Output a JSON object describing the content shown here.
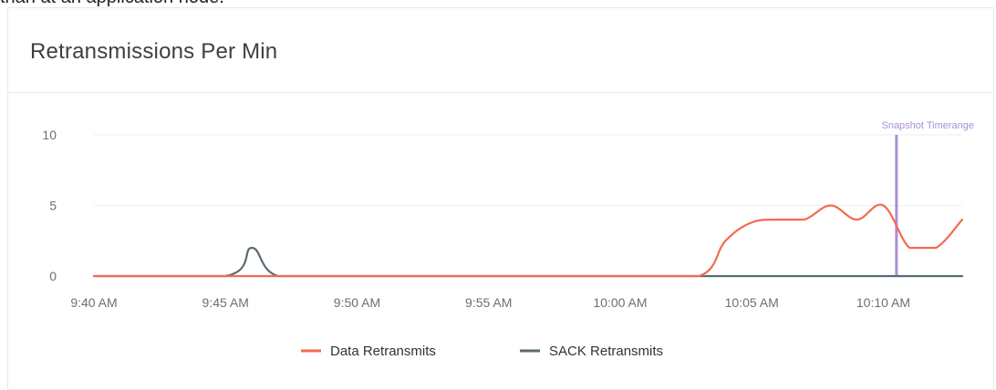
{
  "page": {
    "top_caption": "than at an application node."
  },
  "panel": {
    "title": "Retransmissions Per Min"
  },
  "colors": {
    "data_retransmits": "#f26b4e",
    "sack_retransmits": "#5a6a72",
    "snapshot_line": "#a98fd8",
    "grid": "#eeeeee"
  },
  "chart_data": {
    "type": "line",
    "title": "Retransmissions Per Min",
    "xlabel": "",
    "ylabel": "",
    "ylim": [
      0,
      10
    ],
    "y_ticks": [
      "0",
      "5",
      "10"
    ],
    "x_tick_labels": [
      "9:40 AM",
      "9:45 AM",
      "9:50 AM",
      "9:55 AM",
      "10:00 AM",
      "10:05 AM",
      "10:10 AM"
    ],
    "xlim": [
      "9:40",
      "10:13"
    ],
    "grid": true,
    "legend_position": "bottom",
    "series": [
      {
        "name": "Data Retransmits",
        "color": "#f26b4e",
        "points": [
          [
            "9:40",
            0
          ],
          [
            "9:45",
            0
          ],
          [
            "9:50",
            0
          ],
          [
            "9:55",
            0
          ],
          [
            "10:00",
            0
          ],
          [
            "10:03",
            0
          ],
          [
            "10:04",
            2.5
          ],
          [
            "10:05",
            3.8
          ],
          [
            "10:06",
            4
          ],
          [
            "10:07",
            4
          ],
          [
            "10:08",
            5
          ],
          [
            "10:09",
            4
          ],
          [
            "10:10",
            5
          ],
          [
            "10:11",
            2
          ],
          [
            "10:12",
            2
          ],
          [
            "10:13",
            4
          ]
        ]
      },
      {
        "name": "SACK Retransmits",
        "color": "#5a6a72",
        "points": [
          [
            "9:40",
            0
          ],
          [
            "9:45",
            0
          ],
          [
            "9:46",
            2
          ],
          [
            "9:47",
            0
          ],
          [
            "9:50",
            0
          ],
          [
            "9:55",
            0
          ],
          [
            "10:00",
            0
          ],
          [
            "10:05",
            0
          ],
          [
            "10:10",
            0
          ],
          [
            "10:13",
            0
          ]
        ]
      }
    ],
    "annotations": [
      {
        "label": "Snapshot Timerange",
        "x": "10:10:30"
      }
    ]
  }
}
